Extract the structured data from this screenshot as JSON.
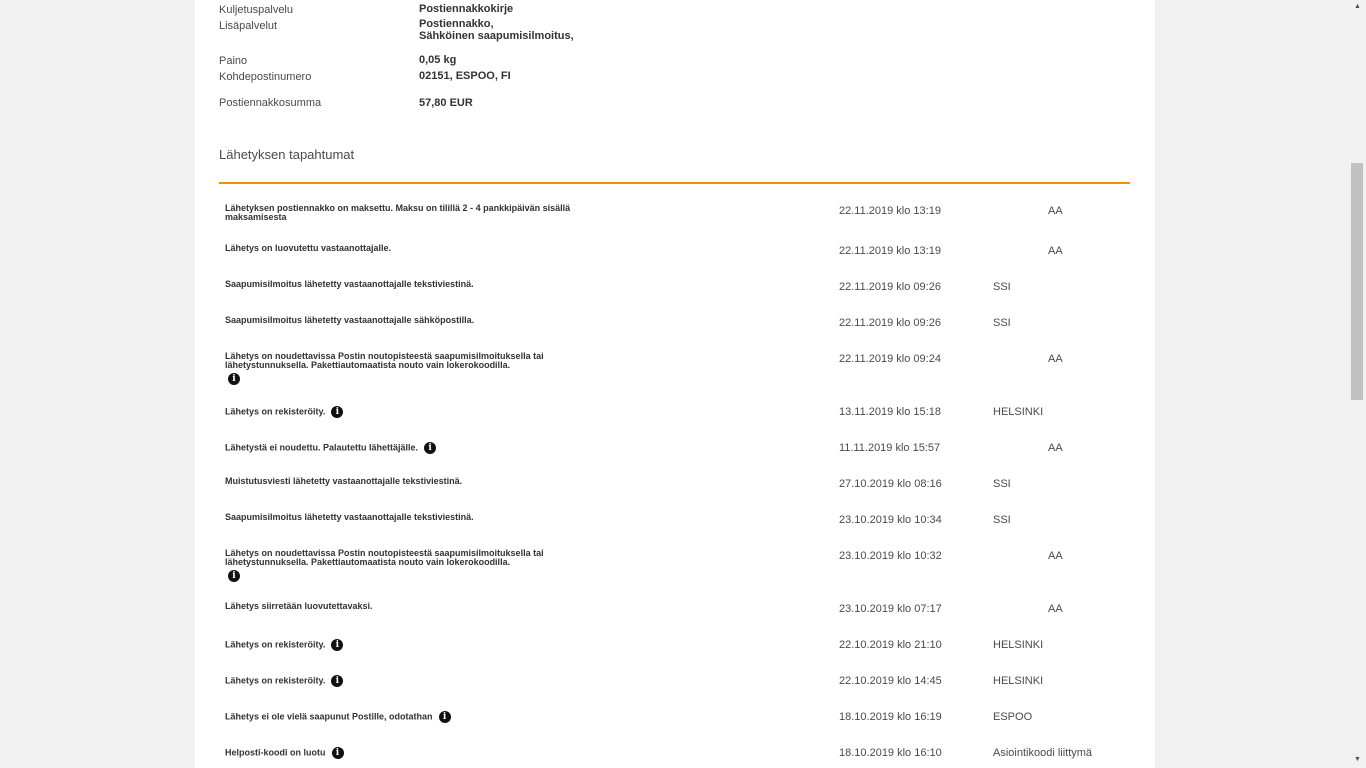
{
  "details": {
    "kuljetuspalvelu_label": "Kuljetuspalvelu",
    "kuljetuspalvelu_value": "Postiennakkokirje",
    "lisapalvelut_label": "Lisäpalvelut",
    "lisapalvelut_value_1": "Postiennakko,",
    "lisapalvelut_value_2": "Sähköinen saapumisilmoitus,",
    "paino_label": "Paino",
    "paino_value": "0,05 kg",
    "kohdepostinumero_label": "Kohdepostinumero",
    "kohdepostinumero_value": "02151, ESPOO, FI",
    "postiennakkosumma_label": "Postiennakkosumma",
    "postiennakkosumma_value": "57,80 EUR"
  },
  "events_title": "Lähetyksen tapahtumat",
  "info_glyph": "i",
  "accent_color": "#f39200",
  "events": [
    {
      "desc": "Lähetyksen postiennakko on maksettu. Maksu on tilillä 2 - 4 pankkipäivän sisällä maksamisesta",
      "date": "22.11.2019 klo 13:19",
      "place": "AA"
    },
    {
      "desc": "Lähetys on luovutettu vastaanottajalle.",
      "date": "22.11.2019 klo 13:19",
      "place": "AA"
    },
    {
      "desc": "Saapumisilmoitus lähetetty vastaanottajalle tekstiviestinä.",
      "date": "22.11.2019 klo 09:26",
      "place": "SSI"
    },
    {
      "desc": "Saapumisilmoitus lähetetty vastaanottajalle sähköpostilla.",
      "date": "22.11.2019 klo 09:26",
      "place": "SSI"
    },
    {
      "desc": "Lähetys on noudettavissa Postin noutopisteestä saapumisilmoituksella tai lähetystunnuksella. Pakettiautomaatista nouto vain lokerokoodilla.",
      "date": "22.11.2019 klo 09:24",
      "place": "AA"
    },
    {
      "desc": "Lähetys on rekisteröity.",
      "date": "13.11.2019 klo 15:18",
      "place": "HELSINKI"
    },
    {
      "desc": "Lähetystä ei noudettu. Palautettu lähettäjälle.",
      "date": "11.11.2019 klo 15:57",
      "place": "AA"
    },
    {
      "desc": "Muistutusviesti lähetetty vastaanottajalle tekstiviestinä.",
      "date": "27.10.2019 klo 08:16",
      "place": "SSI"
    },
    {
      "desc": "Saapumisilmoitus lähetetty vastaanottajalle tekstiviestinä.",
      "date": "23.10.2019 klo 10:34",
      "place": "SSI"
    },
    {
      "desc": "Lähetys on noudettavissa Postin noutopisteestä saapumisilmoituksella tai lähetystunnuksella. Pakettiautomaatista nouto vain lokerokoodilla.",
      "date": "23.10.2019 klo 10:32",
      "place": "AA"
    },
    {
      "desc": "Lähetys siirretään luovutettavaksi.",
      "date": "23.10.2019 klo 07:17",
      "place": "AA"
    },
    {
      "desc": "Lähetys on rekisteröity.",
      "date": "22.10.2019 klo 21:10",
      "place": "HELSINKI"
    },
    {
      "desc": "Lähetys on rekisteröity.",
      "date": "22.10.2019 klo 14:45",
      "place": "HELSINKI"
    },
    {
      "desc": "Lähetys ei ole vielä saapunut Postille, odotathan",
      "date": "18.10.2019 klo 16:19",
      "place": "ESPOO"
    },
    {
      "desc": "Helposti-koodi on luotu",
      "date": "18.10.2019 klo 16:10",
      "place": "Asiointikoodi liittymä"
    }
  ]
}
